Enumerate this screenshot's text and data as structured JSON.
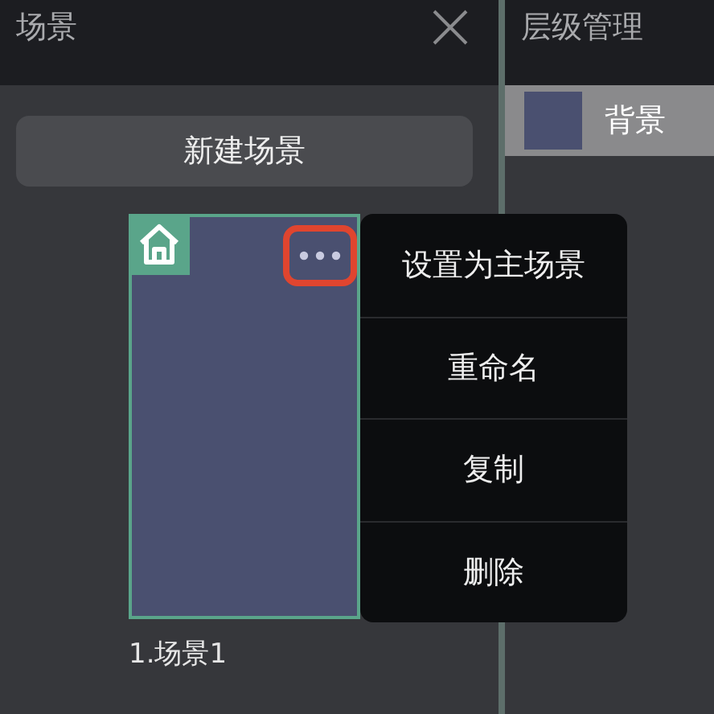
{
  "scene_panel": {
    "title": "场景",
    "new_button": "新建场景",
    "scenes": [
      {
        "name": "1.场景1",
        "is_home": true,
        "menu_open": true,
        "more_highlighted": true
      }
    ]
  },
  "context_menu": {
    "items": [
      "设置为主场景",
      "重命名",
      "复制",
      "删除"
    ]
  },
  "layer_panel": {
    "title": "层级管理",
    "layers": [
      {
        "name": "背景",
        "selected": true,
        "color": "#4a5070"
      }
    ]
  }
}
